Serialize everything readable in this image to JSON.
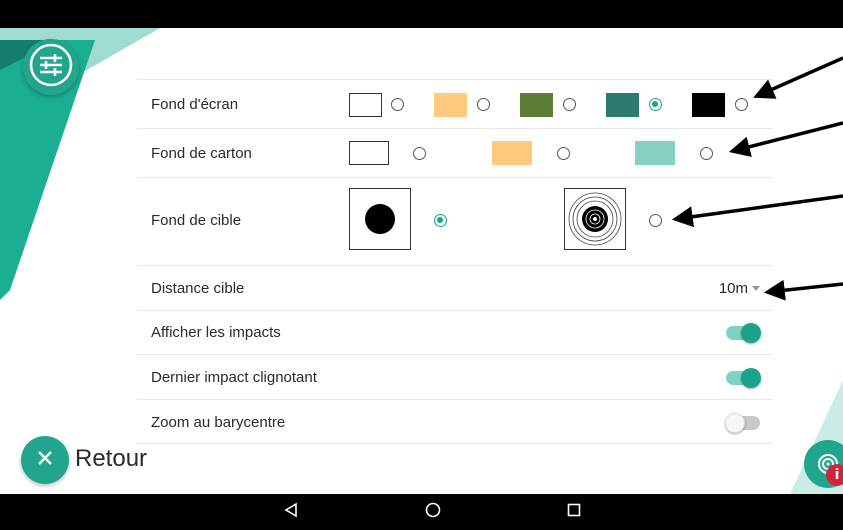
{
  "colors": {
    "accent": "#1aa38b",
    "fab": "#22a58d",
    "badge": "#d5213b"
  },
  "toolbar": {
    "settings_icon": "sliders-icon"
  },
  "settings": {
    "fond_ecran": {
      "label": "Fond d'écran",
      "options": [
        {
          "color": "#ffffff",
          "selected": false
        },
        {
          "color": "#ffc97e",
          "selected": false
        },
        {
          "color": "#5d7d37",
          "selected": false
        },
        {
          "color": "#2a7a6f",
          "selected": true
        },
        {
          "color": "#000000",
          "selected": false
        }
      ]
    },
    "fond_carton": {
      "label": "Fond de carton",
      "options": [
        {
          "color": "#ffffff",
          "selected": false
        },
        {
          "color": "#ffc97e",
          "selected": false
        },
        {
          "color": "#86d0c3",
          "selected": false
        }
      ]
    },
    "fond_cible": {
      "label": "Fond de cible",
      "options": [
        {
          "icon": "solid-target-icon",
          "selected": true
        },
        {
          "icon": "ringed-target-icon",
          "selected": false
        }
      ]
    },
    "distance": {
      "label": "Distance cible",
      "value": "10m"
    },
    "afficher_impacts": {
      "label": "Afficher les impacts",
      "on": true
    },
    "dernier_impact": {
      "label": "Dernier impact clignotant",
      "on": true
    },
    "zoom_barycentre": {
      "label": "Zoom au barycentre",
      "on": false
    }
  },
  "footer": {
    "back_label": "Retour",
    "info_badge": "i"
  }
}
